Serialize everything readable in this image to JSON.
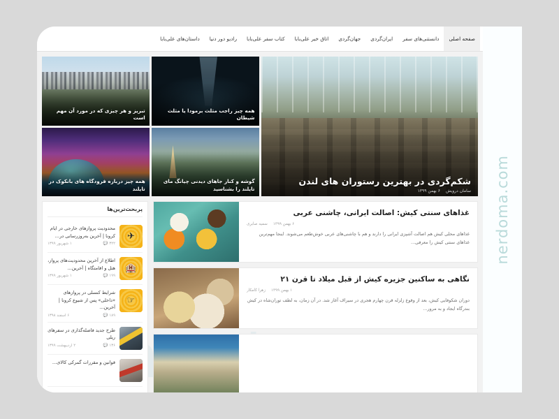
{
  "watermark": {
    "side": "nerdoma.com",
    "center": "nerdoma"
  },
  "nav": {
    "items": [
      {
        "label": "صفحه اصلی",
        "active": true
      },
      {
        "label": "دانستنی‌های سفر",
        "active": false
      },
      {
        "label": "ایران‌گردی",
        "active": false
      },
      {
        "label": "جهان‌گردی",
        "active": false
      },
      {
        "label": "اتاق خبر علی‌بابا",
        "active": false
      },
      {
        "label": "کتاب سفر علی‌بابا",
        "active": false
      },
      {
        "label": "رادیو دور دنیا",
        "active": false
      },
      {
        "label": "داستان‌های علی‌بابا",
        "active": false
      }
    ]
  },
  "hero": {
    "tiles": [
      {
        "title": "تبریز و هر چیزی که در مورد آن مهم است",
        "image": "tabriz-city-photo"
      },
      {
        "title": "همه چیز راجب مثلث برمودا یا مثلث شیطان",
        "image": "bermuda-triangle-photo"
      },
      {
        "title": "همه چیز درباره فرودگاه های بانکوک در تایلند",
        "image": "bangkok-airport-photo"
      },
      {
        "title": "گوشه و کنار جاهای دیدنی چیانگ مای تایلند را بشناسید",
        "image": "chiang-mai-photo"
      }
    ],
    "main": {
      "title": "شکم‌گردی در بهترین رستوران های لندن",
      "author": "سامان درویش",
      "date": "۶ بهمن ۱۳۹۹",
      "image": "london-restaurant-photo"
    }
  },
  "sidebar": {
    "heading": "پربحث‌ترین‌ها",
    "items": [
      {
        "title": "محدودیت پروازهای خارجی در ایام کرونا | آخرین به‌روزرسانی در...",
        "date": "۱ شهریور ۱۳۹۹",
        "comments": "۳۲۲",
        "thumb": "badge-icon"
      },
      {
        "title": "اطلاع از آخرین محدودیت‌های پرواز، هتل و اقامتگاه | آخرین...",
        "date": "۱ شهریور ۱۳۹۹",
        "comments": "۱۹۹",
        "thumb": "badge-icon"
      },
      {
        "title": "شرایط کنسلی در پروازهای «داخلی» پس از شیوع کرونا | آخرین...",
        "date": "۶ اسفند ۱۳۹۸",
        "comments": "۱۸۹",
        "thumb": "badge-icon"
      },
      {
        "title": "طرح جدید فاصله‌گذاری در سفرهای ریلی",
        "date": "۲ اردیبهشت ۱۳۹۹",
        "comments": "۱۳۶",
        "thumb": "train-photo"
      },
      {
        "title": "قوانین و مقررات گمرکی کالای...",
        "date": "",
        "comments": "",
        "thumb": "customs-photo"
      }
    ]
  },
  "articles": [
    {
      "title": "غذاهای سنتی کیش: اصالت ایرانی، چاشنی عربی",
      "author": "سمیه صابری",
      "date": "۶ بهمن ۱۳۹۹",
      "excerpt": "غذاهای محلی کیش هم اصالت آشپزی ایرانی را دارند و هم با چاشنی‌های عربی خوش‌طعم می‌شوند. اینجا مهم‌ترین غذاهای سنتی کیش را معرفی...",
      "image": "kish-traditional-food-photo"
    },
    {
      "title": "نگاهی به ساکنین جزیره کیش از قبل میلاد تا قرن ۲۱",
      "author": "زهرا کامکار",
      "date": "۱ بهمن ۱۳۹۹",
      "excerpt": "دوران شکوفایی کیش، بعد از وقوع زلزله قرن چهارم هجری در سیراف آغاز شد. در آن زمان، به لطف توران‌شاه در کیش بندرگاه ایجاد و به مرور...",
      "image": "kish-residents-photo"
    },
    {
      "title": "",
      "author": "",
      "date": "",
      "excerpt": "",
      "image": "kish-coast-photo"
    }
  ]
}
